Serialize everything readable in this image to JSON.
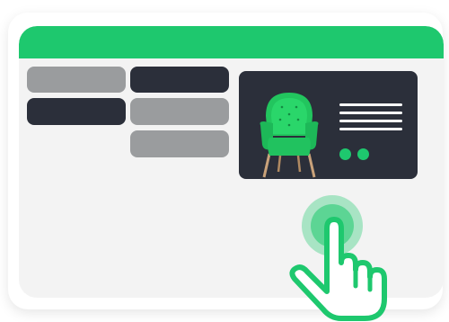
{
  "colors": {
    "accent_green": "#1ec86e",
    "dark": "#2b2f3a",
    "gray": "#9a9c9e",
    "panel_bg": "#f3f3f3"
  },
  "icons": {
    "product_image": "green-armchair-icon",
    "pointer": "tapping-hand-icon"
  }
}
